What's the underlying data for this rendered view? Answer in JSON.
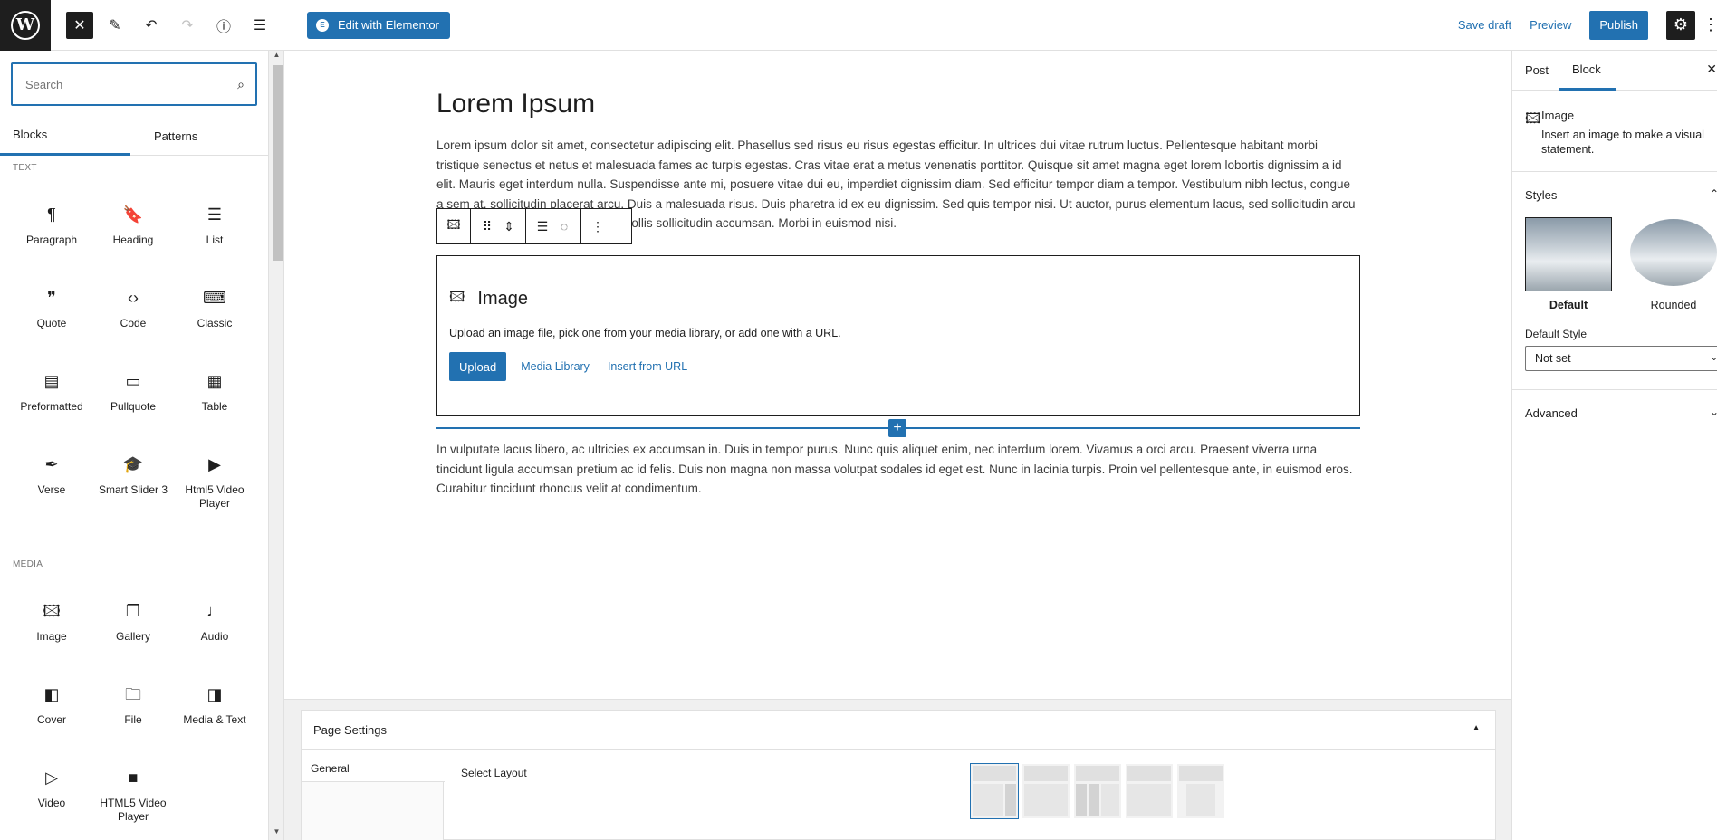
{
  "topbar": {
    "logo": "W",
    "elementor_label": "Edit with Elementor",
    "save_draft": "Save draft",
    "preview": "Preview",
    "publish": "Publish"
  },
  "inserter": {
    "search_placeholder": "Search",
    "tabs": [
      "Blocks",
      "Patterns"
    ],
    "categories": [
      {
        "name": "TEXT",
        "blocks": [
          {
            "label": "Paragraph",
            "icon": "¶"
          },
          {
            "label": "Heading",
            "icon": "🔖"
          },
          {
            "label": "List",
            "icon": "☰"
          },
          {
            "label": "Quote",
            "icon": "❞"
          },
          {
            "label": "Code",
            "icon": "‹›"
          },
          {
            "label": "Classic",
            "icon": "⌨"
          },
          {
            "label": "Preformatted",
            "icon": "▤"
          },
          {
            "label": "Pullquote",
            "icon": "▭"
          },
          {
            "label": "Table",
            "icon": "▦"
          },
          {
            "label": "Verse",
            "icon": "✒"
          },
          {
            "label": "Smart Slider 3",
            "icon": "🎓"
          },
          {
            "label": "Html5 Video Player",
            "icon": "▶"
          }
        ]
      },
      {
        "name": "MEDIA",
        "blocks": [
          {
            "label": "Image",
            "icon": "🖾"
          },
          {
            "label": "Gallery",
            "icon": "❐"
          },
          {
            "label": "Audio",
            "icon": "♩"
          },
          {
            "label": "Cover",
            "icon": "◧"
          },
          {
            "label": "File",
            "icon": "🗀"
          },
          {
            "label": "Media & Text",
            "icon": "◨"
          },
          {
            "label": "Video",
            "icon": "▷"
          },
          {
            "label": "HTML5 Video Player",
            "icon": "■"
          }
        ]
      }
    ]
  },
  "editor": {
    "title": "Lorem Ipsum",
    "paragraph1": "Lorem ipsum dolor sit amet, consectetur adipiscing elit. Phasellus sed risus eu risus egestas efficitur. In ultrices dui vitae rutrum luctus. Pellentesque habitant morbi tristique senectus et netus et malesuada fames ac turpis egestas. Cras vitae erat a metus venenatis porttitor. Quisque sit amet magna eget lorem lobortis dignissim a id elit. Mauris eget interdum nulla. Suspendisse ante mi, posuere vitae dui eu, imperdiet dignissim diam. Sed efficitur tempor diam a tempor. Vestibulum nibh lectus, congue a sem at, sollicitudin placerat arcu. Duis a malesuada risus. Duis pharetra id ex eu dignissim. Sed quis tempor nisi. Ut auctor, purus elementum lacus, sed sollicitudin arcu ex at arcu. Mauris gravida magna mollis sollicitudin accumsan. Morbi in euismod nisi.",
    "image_block": {
      "title": "Image",
      "description": "Upload an image file, pick one from your media library, or add one with a URL.",
      "upload": "Upload",
      "media_library": "Media Library",
      "insert_url": "Insert from URL"
    },
    "paragraph2": "In vulputate lacus libero, ac ultricies ex accumsan in. Duis in tempor purus. Nunc quis aliquet enim, nec interdum lorem. Vivamus a orci arcu. Praesent viverra urna tincidunt ligula accumsan pretium ac id felis. Duis non magna non massa volutpat sodales id eget est. Nunc in lacinia turpis. Proin vel pellentesque ante, in euismod eros. Curabitur tincidunt rhoncus velit at condimentum."
  },
  "page_settings": {
    "title": "Page Settings",
    "nav_item": "General",
    "select_layout": "Select Layout"
  },
  "sidebar": {
    "tabs": [
      "Post",
      "Block"
    ],
    "block_name": "Image",
    "block_desc": "Insert an image to make a visual statement.",
    "styles_title": "Styles",
    "style_default": "Default",
    "style_rounded": "Rounded",
    "default_style_label": "Default Style",
    "default_style_value": "Not set",
    "advanced_title": "Advanced"
  },
  "colors": {
    "accent": "#2271b1",
    "dark": "#1e1e1e"
  }
}
